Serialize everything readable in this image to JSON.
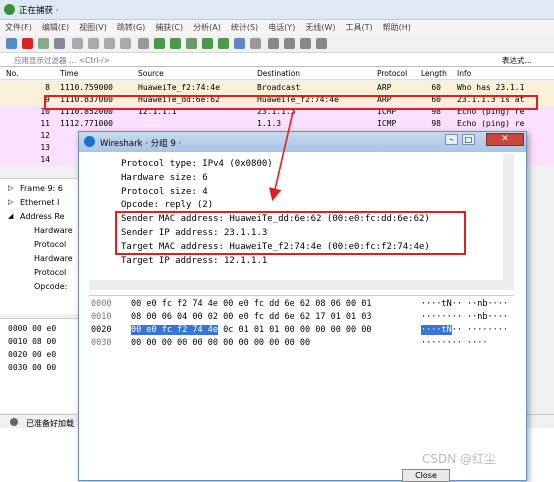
{
  "window": {
    "title": "正在捕获 ·"
  },
  "menu": [
    "文件(F)",
    "编辑(E)",
    "视图(V)",
    "跳转(G)",
    "捕获(C)",
    "分析(A)",
    "统计(S)",
    "电话(Y)",
    "无线(W)",
    "工具(T)",
    "帮助(H)"
  ],
  "filter": {
    "placeholder": "应用显示过滤器 … <Ctrl-/>",
    "expression_label": "表达式…"
  },
  "columns": [
    "No.",
    "Time",
    "Source",
    "Destination",
    "Protocol",
    "Length",
    "Info"
  ],
  "packets": [
    {
      "no": "8",
      "time": "1110.759000",
      "src": "HuaweiTe_f2:74:4e",
      "dst": "Broadcast",
      "proto": "ARP",
      "len": "60",
      "info": "Who has 23.1.1",
      "color": "#faf0d7"
    },
    {
      "no": "9",
      "time": "1110.837000",
      "src": "HuaweiTe_dd:6e:62",
      "dst": "HuaweiTe_f2:74:4e",
      "proto": "ARP",
      "len": "60",
      "info": "23.1.1.3 is at",
      "color": "#faf0d7"
    },
    {
      "no": "10",
      "time": "1110.852000",
      "src": "12.1.1.1",
      "dst": "23.1.1.3",
      "proto": "ICMP",
      "len": "98",
      "info": "Echo (ping) re",
      "color": "#fce0ff"
    },
    {
      "no": "11",
      "time": "1112.771000",
      "src": "",
      "dst": "1.1.3",
      "proto": "ICMP",
      "len": "98",
      "info": "Echo (ping) re",
      "color": "#fce0ff"
    },
    {
      "no": "12",
      "time": "",
      "src": "",
      "dst": "",
      "proto": "",
      "len": "",
      "info": "re",
      "color": "#fce0ff"
    },
    {
      "no": "13",
      "time": "",
      "src": "",
      "dst": "",
      "proto": "",
      "len": "",
      "info": "re",
      "color": "#fce0ff"
    },
    {
      "no": "14",
      "time": "",
      "src": "",
      "dst": "",
      "proto": "",
      "len": "",
      "info": "re",
      "color": "#fce0ff"
    }
  ],
  "detail_tree": [
    "Frame 9: 6",
    "Ethernet I",
    "Address Re",
    "Hardware",
    "Protocol",
    "Hardware",
    "Protocol",
    "Opcode:"
  ],
  "hex_left": [
    "0000  00 e0",
    "0010  08 00",
    "0020  00 e0",
    "0030  00 00"
  ],
  "status": {
    "text": "已准备好加载"
  },
  "dialog": {
    "title": "Wireshark · 分组 9 ·",
    "close_label": "Close",
    "fields": [
      "Protocol type: IPv4 (0x0800)",
      "Hardware size: 6",
      "Protocol size: 4",
      "Opcode: reply (2)",
      "Sender MAC address: HuaweiTe_dd:6e:62 (00:e0:fc:dd:6e:62)",
      "Sender IP address: 23.1.1.3",
      "Target MAC address: HuaweiTe_f2:74:4e (00:e0:fc:f2:74:4e)",
      "Target IP address: 12.1.1.1"
    ],
    "hex": [
      {
        "off": "0000",
        "bytes": "00 e0 fc f2 74 4e 00 e0  fc dd 6e 62 08 06 00 01",
        "ascii": "····tN··  ··nb····"
      },
      {
        "off": "0010",
        "bytes": "08 00 06 04 00 02 00 e0  fc dd 6e 62 17 01 01 03",
        "ascii": "········  ··nb····"
      },
      {
        "off": "0020",
        "hl": "00 e0 fc f2 74 4e",
        "bytes_rest": " 0c 01  01 01 00 00 00 00 00 00",
        "ascii_hl": "····tN",
        "ascii_rest": "··  ········"
      },
      {
        "off": "0030",
        "bytes": "00 00 00 00 00 00 00 00  00 00 00 00",
        "ascii": "········  ····"
      }
    ]
  },
  "watermark": "CSDN @红尘"
}
